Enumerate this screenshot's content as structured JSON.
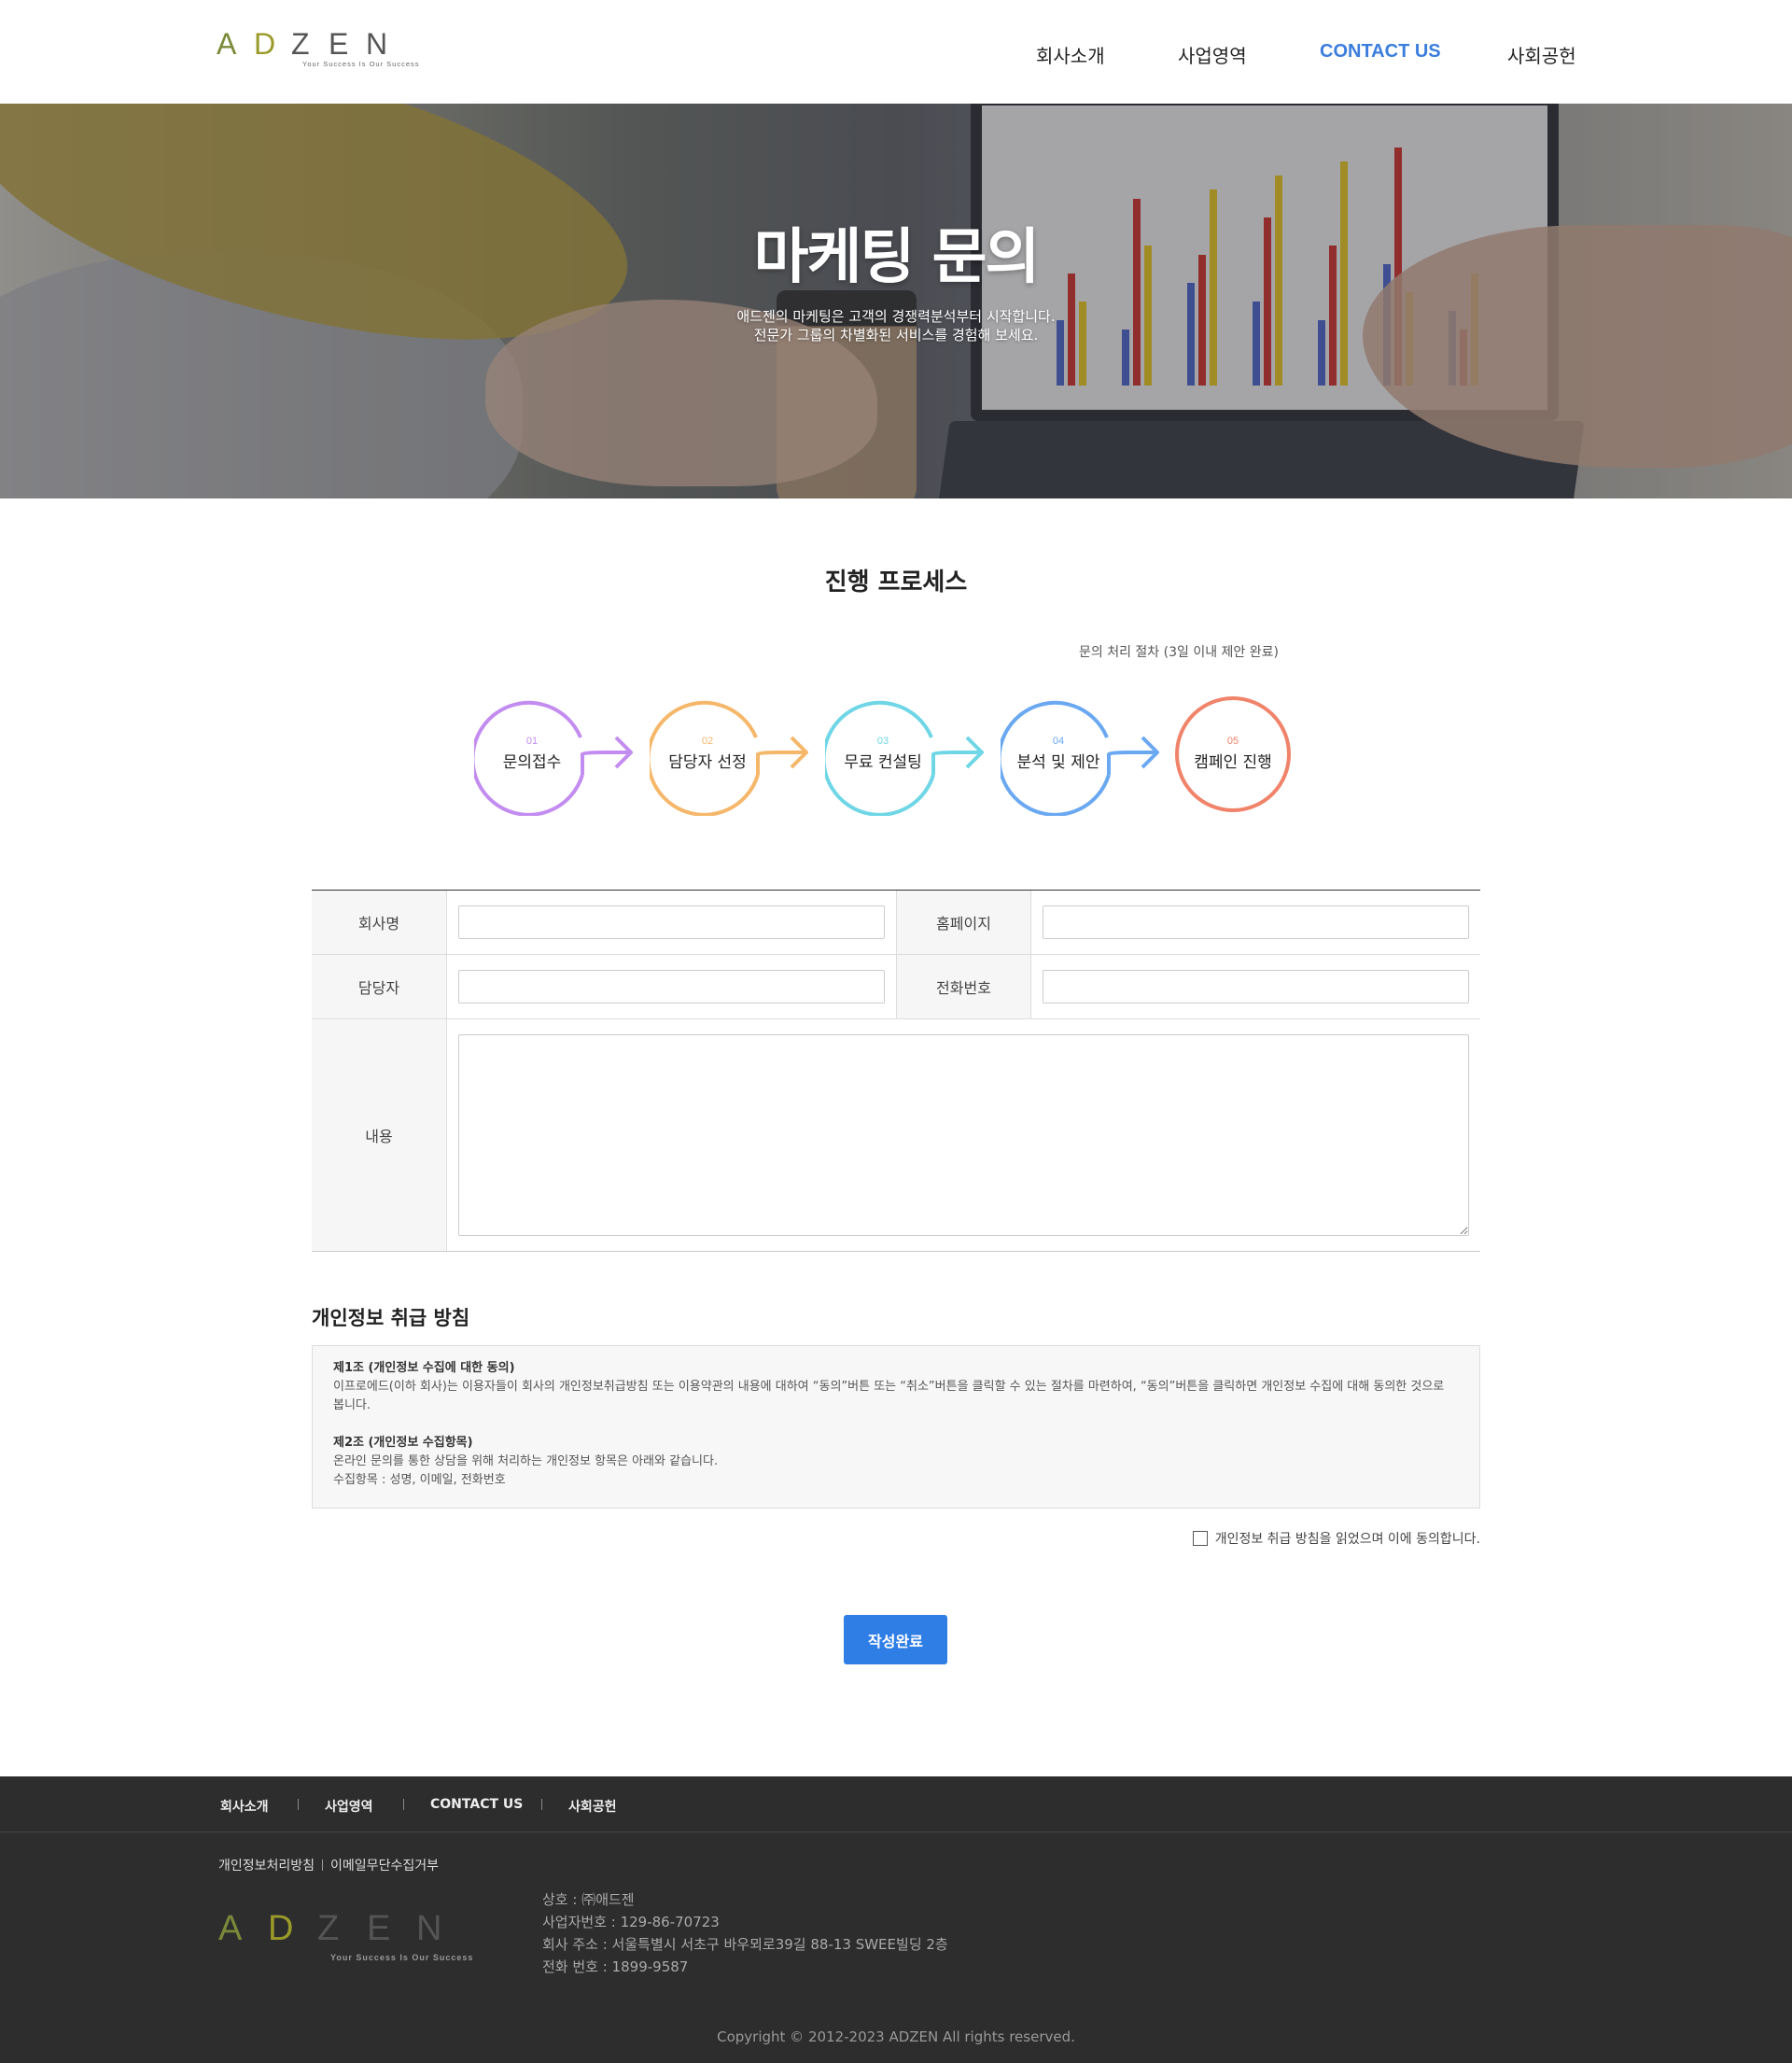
{
  "brand": {
    "logo_letters": [
      "A",
      "D",
      "Z",
      "E",
      "N"
    ],
    "logo_tagline": "Your Success Is Our Success",
    "logo_colors": {
      "A": "#7a8a3a",
      "D": "#9a9a2a",
      "Z": "#555555",
      "E": "#555555",
      "N": "#555555"
    }
  },
  "nav": {
    "items": [
      {
        "label": "회사소개",
        "active": false
      },
      {
        "label": "사업영역",
        "active": false
      },
      {
        "label": "CONTACT US",
        "active": true
      },
      {
        "label": "사회공헌",
        "active": false
      }
    ]
  },
  "hero": {
    "title": "마케팅 문의",
    "subtitle_line1": "애드젠의 마케팅은 고객의 경쟁력분석부터 시작합니다.",
    "subtitle_line2": "전문가 그룹의 차별화된 서비스를 경험해 보세요."
  },
  "process": {
    "title": "진행 프로세스",
    "note": "문의 처리 절차 (3일 이내 제안 완료)",
    "steps": [
      {
        "num": "01",
        "label": "문의접수",
        "color": "#c38cf0"
      },
      {
        "num": "02",
        "label": "담당자 선정",
        "color": "#f5b76a"
      },
      {
        "num": "03",
        "label": "무료 컨설팅",
        "color": "#6fd6e6"
      },
      {
        "num": "04",
        "label": "분석 및 제안",
        "color": "#6aa8f2"
      },
      {
        "num": "05",
        "label": "캠페인 진행",
        "color": "#f0836a"
      }
    ]
  },
  "form": {
    "company_label": "회사명",
    "company_value": "",
    "homepage_label": "홈페이지",
    "homepage_value": "",
    "manager_label": "담당자",
    "manager_value": "",
    "phone_label": "전화번호",
    "phone_value": "",
    "content_label": "내용",
    "content_value": ""
  },
  "privacy": {
    "title": "개인정보 취급 방침",
    "article1_title": "제1조 (개인정보 수집에 대한 동의)",
    "article1_body": "이프로에드(이하 회사)는 이용자들이 회사의 개인정보취급방침 또는 이용약관의 내용에 대하여 “동의”버튼 또는 “취소”버튼을 클릭할 수 있는 절차를 마련하여, “동의”버튼을 클릭하면 개인정보 수집에 대해 동의한 것으로 봅니다.",
    "article2_title": "제2조 (개인정보 수집항목)",
    "article2_body1": "온라인 문의를 통한 상담을 위해 처리하는 개인정보 항목은 아래와 같습니다.",
    "article2_body2": "수집항목 : 성명, 이메일, 전화번호",
    "agree_label": "개인정보 취급 방침을 읽었으며 이에 동의합니다.",
    "agree_checked": false
  },
  "submit_label": "작성완료",
  "footer": {
    "nav": [
      "회사소개",
      "사업영역",
      "CONTACT US",
      "사회공헌"
    ],
    "link1": "개인정보처리방침",
    "link2": "이메일무단수집거부",
    "company": "상호 : ㈜애드젠",
    "biz_no": "사업자번호 : 129-86-70723",
    "address": "회사 주소 : 서울특별시 서초구 바우뫼로39길 88-13 SWEE빌딩 2층",
    "tel": "전화 번호 : 1899-9587",
    "copyright": "Copyright © 2012-2023 ADZEN All rights reserved."
  },
  "colors": {
    "accent": "#2f7ee6",
    "nav_active": "#3b7ddd",
    "footer_bg": "#2d2d2d"
  }
}
